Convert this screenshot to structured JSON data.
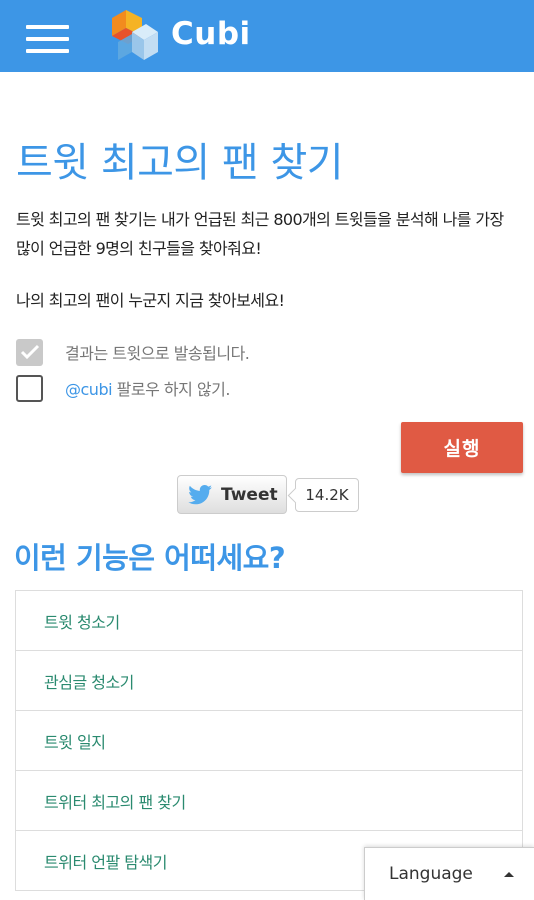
{
  "header": {
    "brand": "Cubi",
    "menu_icon": "hamburger-menu-icon",
    "logo_icon": "cubi-logo-icon",
    "color": "#3d96e6"
  },
  "main": {
    "title": "트윗 최고의 팬 찾기",
    "description": "트윗 최고의 팬 찾기는 내가 언급된 최근 800개의 트윗들을 분석해 나를 가장 많이 언급한 9명의 친구들을 찾아줘요!",
    "description2": "나의 최고의 팬이 누군지 지금 찾아보세요!",
    "options": [
      {
        "label": "결과는 트윗으로 발송됩니다.",
        "checked": true
      },
      {
        "mention": "@cubi",
        "label": " 팔로우 하지 않기.",
        "checked": false
      }
    ],
    "run_button": "실행",
    "run_button_color": "#e05a44"
  },
  "tweet": {
    "label": "Tweet",
    "count": "14.2K",
    "icon": "twitter-bird-icon"
  },
  "features": {
    "title": "이런 기능은 어떠세요?",
    "items": [
      "트윗 청소기",
      "관심글 청소기",
      "트윗 일지",
      "트위터 최고의 팬 찾기",
      "트위터 언팔 탐색기"
    ]
  },
  "language": {
    "label": "Language",
    "icon": "caret-up-icon"
  }
}
